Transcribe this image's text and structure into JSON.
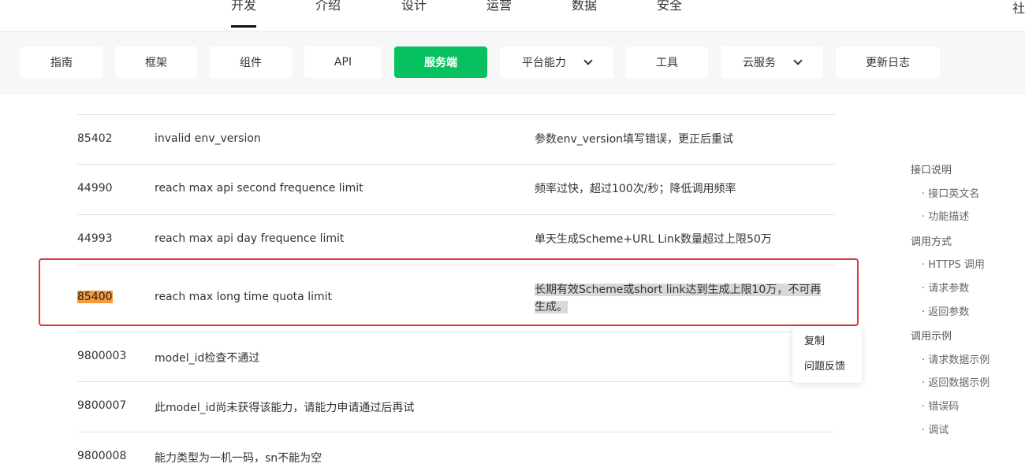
{
  "topnav": {
    "items": [
      "开发",
      "介绍",
      "设计",
      "运营",
      "数据",
      "安全"
    ],
    "more": "社"
  },
  "subnav": {
    "items": [
      "指南",
      "框架",
      "组件",
      "API",
      "服务端",
      "平台能力",
      "工具",
      "云服务",
      "更新日志"
    ]
  },
  "table": {
    "rows": [
      {
        "code": "85402",
        "msg": "invalid env_version",
        "desc": "参数env_version填写错误，更正后重试"
      },
      {
        "code": "44990",
        "msg": "reach max api second frequence limit",
        "desc": "频率过快，超过100次/秒；降低调用频率"
      },
      {
        "code": "44993",
        "msg": "reach max api day frequence limit",
        "desc": "单天生成Scheme+URL Link数量超过上限50万"
      },
      {
        "code": "85400",
        "msg": "reach max long time quota limit",
        "desc": "长期有效Scheme或short link达到生成上限10万，不可再生成。"
      },
      {
        "code": "9800003",
        "msg": "model_id检查不通过",
        "desc": ""
      },
      {
        "code": "9800007",
        "msg": "此model_id尚未获得该能力，请能力申请通过后再试",
        "desc": ""
      },
      {
        "code": "9800008",
        "msg": "能力类型为一机一码，sn不能为空",
        "desc": ""
      }
    ]
  },
  "context_menu": {
    "items": [
      "复制",
      "问题反馈"
    ]
  },
  "toc": {
    "items": [
      "接口说明",
      "接口英文名",
      "功能描述",
      "调用方式",
      "HTTPS 调用",
      "请求参数",
      "返回参数",
      "调用示例",
      "请求数据示例",
      "返回数据示例",
      "错误码",
      "调试"
    ]
  },
  "colors": {
    "accent": "#07c160",
    "highlight_box": "#e0393e",
    "selection_code": "#f59a3c",
    "selection_text": "#d9d9d9"
  }
}
